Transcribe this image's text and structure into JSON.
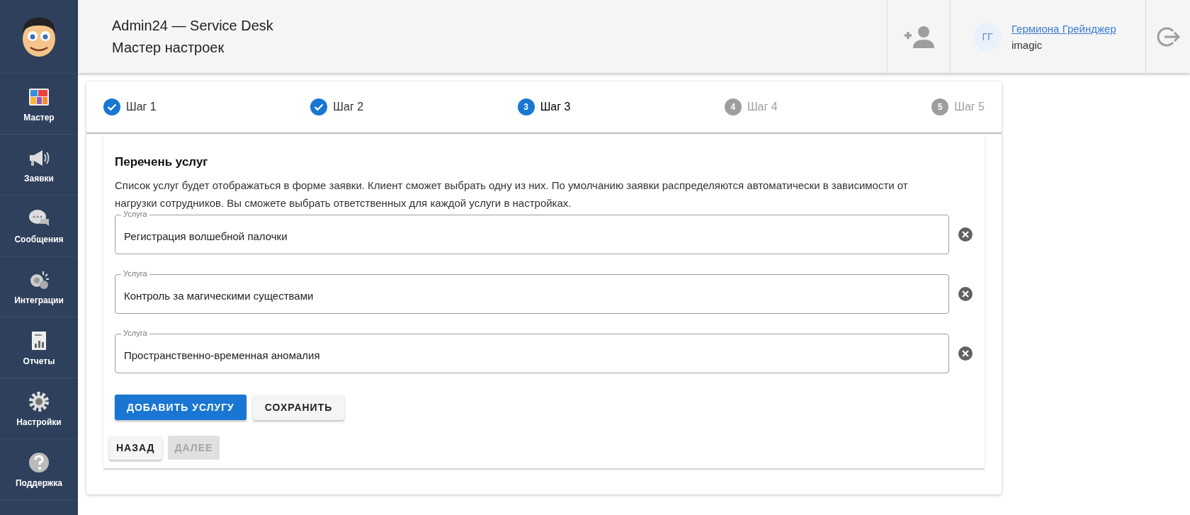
{
  "sidebar": {
    "items": [
      {
        "kind": "wizard",
        "label": "Мастер"
      },
      {
        "kind": "tickets",
        "label": "Заявки"
      },
      {
        "kind": "messages",
        "label": "Сообщения"
      },
      {
        "kind": "integrations",
        "label": "Интеграции"
      },
      {
        "kind": "reports",
        "label": "Отчеты"
      },
      {
        "kind": "settings",
        "label": "Настройки"
      },
      {
        "kind": "support",
        "label": "Поддержка"
      }
    ]
  },
  "header": {
    "title": "Admin24 — Service Desk",
    "subtitle": "Мастер настроек",
    "user": {
      "initials": "ГГ",
      "name": "Гермиона Грейнджер",
      "login": "imagic"
    }
  },
  "stepper": {
    "steps": [
      {
        "label": "Шаг 1",
        "completed": true,
        "selected": false,
        "disabled": false
      },
      {
        "label": "Шаг 2",
        "completed": true,
        "selected": false,
        "disabled": false
      },
      {
        "number": "3",
        "label": "Шаг 3",
        "completed": false,
        "selected": true,
        "disabled": false
      },
      {
        "number": "4",
        "label": "Шаг 4",
        "completed": false,
        "selected": false,
        "disabled": true
      },
      {
        "number": "5",
        "label": "Шаг 5",
        "completed": false,
        "selected": false,
        "disabled": true
      }
    ]
  },
  "section": {
    "title": "Перечень услуг",
    "description": "Список услуг будет отображаться в форме заявки. Клиент сможет выбрать одну из них. По умолчанию заявки распределяются автоматически в зависимости от нагрузки сотрудников. Вы сможете выбрать ответственных для каждой услуги в настройках.",
    "services": [
      {
        "label": "Услуга",
        "value": "Регистрация волшебной палочки"
      },
      {
        "label": "Услуга",
        "value": "Контроль за магическими существами"
      },
      {
        "label": "Услуга",
        "value": "Пространственно-временная аномалия"
      }
    ],
    "actions": [
      {
        "label": "ДОБАВИТЬ УСЛУГУ",
        "kind": "primary"
      },
      {
        "label": "СОХРАНИТЬ",
        "kind": "secondary"
      }
    ]
  },
  "navigation": [
    {
      "label": "НАЗАД",
      "disabled": false
    },
    {
      "label": "ДАЛЕЕ",
      "disabled": true
    }
  ]
}
